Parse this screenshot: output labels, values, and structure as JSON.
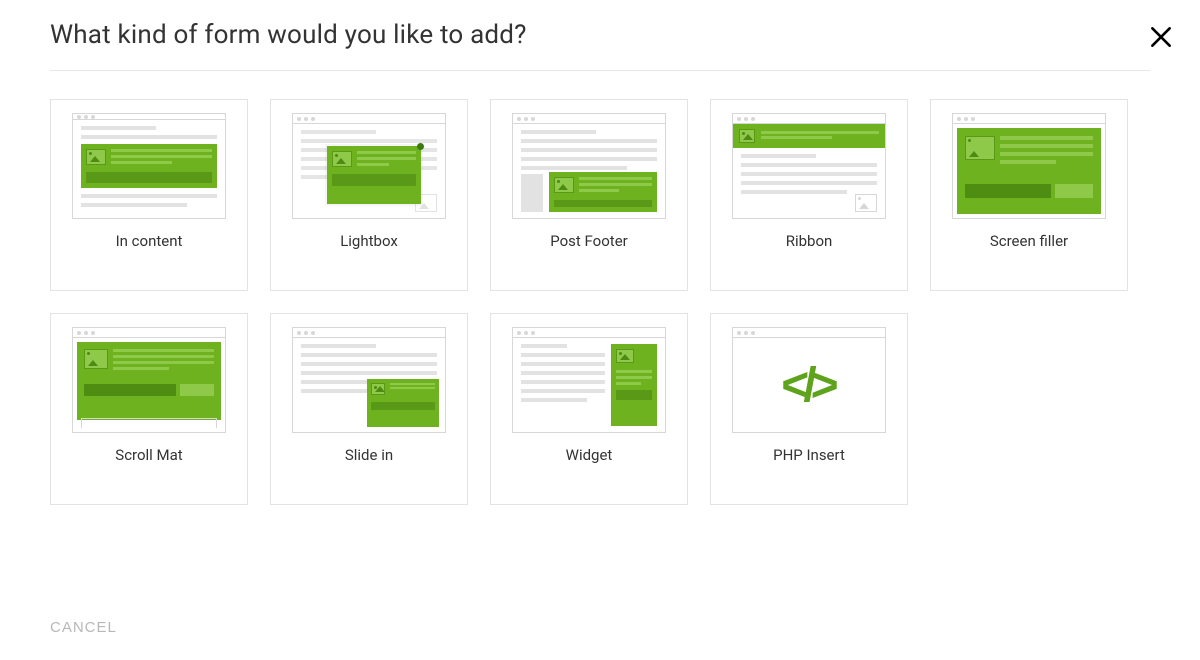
{
  "dialog": {
    "title": "What kind of form would you like to add?",
    "cancel_label": "CANCEL"
  },
  "options": [
    {
      "id": "in-content",
      "label": "In content"
    },
    {
      "id": "lightbox",
      "label": "Lightbox"
    },
    {
      "id": "post-footer",
      "label": "Post Footer"
    },
    {
      "id": "ribbon",
      "label": "Ribbon"
    },
    {
      "id": "screen-filler",
      "label": "Screen filler"
    },
    {
      "id": "scroll-mat",
      "label": "Scroll Mat"
    },
    {
      "id": "slide-in",
      "label": "Slide in"
    },
    {
      "id": "widget",
      "label": "Widget"
    },
    {
      "id": "php-insert",
      "label": "PHP Insert"
    }
  ],
  "colors": {
    "accent": "#6eb21f",
    "accent_dark": "#5a9818",
    "border": "#e3e3e3"
  }
}
